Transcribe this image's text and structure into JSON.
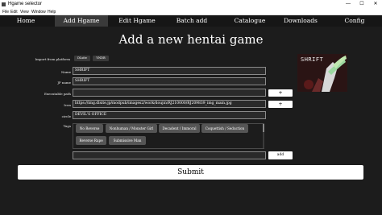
{
  "window": {
    "title": "Hgame selector",
    "minimize": "—",
    "maximize": "☐",
    "close": "✕"
  },
  "menu": [
    "File",
    "Edit",
    "View",
    "Window",
    "Help"
  ],
  "nav": [
    "Home",
    "Add Hgame",
    "Edit Hgame",
    "Batch add",
    "Catalogue",
    "Downloads",
    "Config"
  ],
  "nav_active": 1,
  "page_title": "Add a new hentai game",
  "import": {
    "label": "Import from platform",
    "buttons": [
      "DLsite",
      "VNDB"
    ]
  },
  "form": {
    "name_label": "Name",
    "name_value": "SHRIFT",
    "jp_name_label": "JP name",
    "jp_name_value": "SHRIFT",
    "exec_label": "Executable path",
    "exec_value": "",
    "icon_label": "Icon",
    "icon_value": "https://img.dlsite.jp/modpub/images2/work/doujin/RJ210000/RJ209839_img_main.jpg",
    "circle_label": "circle",
    "circle_value": "DEVIL'S OFFICE",
    "tags_label": "Tags",
    "plus": "+"
  },
  "tags": [
    "No Reverse",
    "Nonhuman / Monster Girl",
    "Decadent / Immoral",
    "Coquettish / Seduction",
    "Reverse Rape",
    "Submissive Man"
  ],
  "tag_input": {
    "value": ""
  },
  "add_label": "add",
  "submit_label": "Submit",
  "cover": {
    "text": "SHRIFT"
  }
}
